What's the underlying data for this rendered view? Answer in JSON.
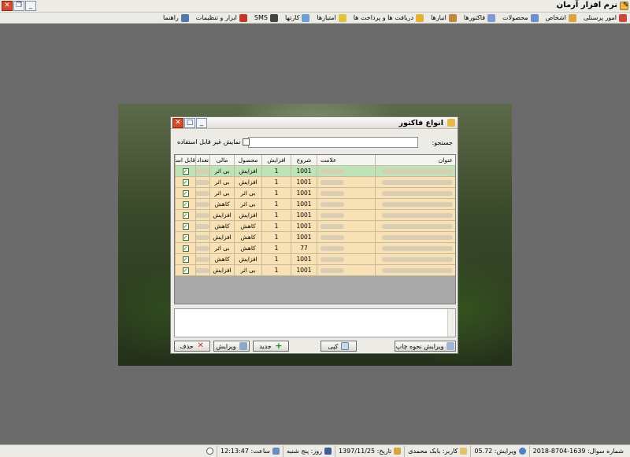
{
  "app": {
    "title": "نرم افزار آرمان"
  },
  "menu": {
    "items": [
      {
        "label": "امور پرسنلی",
        "icon": "staff-icon",
        "color": "#c94a3a"
      },
      {
        "label": "اشخاص",
        "icon": "people-icon",
        "color": "#d9a441"
      },
      {
        "label": "محصولات",
        "icon": "products-icon",
        "color": "#6b8fcf"
      },
      {
        "label": "فاکتورها",
        "icon": "invoices-icon",
        "color": "#7d9bd1"
      },
      {
        "label": "انبارها",
        "icon": "warehouse-icon",
        "color": "#b98b3b"
      },
      {
        "label": "دریافت ها و پرداخت ها",
        "icon": "payments-icon",
        "color": "#e1b23a"
      },
      {
        "label": "امتیازها",
        "icon": "points-icon",
        "color": "#e3c23b"
      },
      {
        "label": "کارتها",
        "icon": "cards-icon",
        "color": "#6aa0d6"
      },
      {
        "label": "SMS",
        "icon": "sms-icon",
        "color": "#444444"
      },
      {
        "label": "ابزار و تنظیمات",
        "icon": "tools-icon",
        "color": "#c0392b"
      },
      {
        "label": "راهنما",
        "icon": "help-icon",
        "color": "#5577aa"
      }
    ]
  },
  "dialog": {
    "title": "انواع فاکتور",
    "search_label": "جستجو:",
    "search_value": "",
    "show_unusable_label": "نمایش غیر قابل استفاده",
    "columns": {
      "title": "عنوان",
      "sign": "علامت",
      "start": "شروع",
      "effect": "افزایش",
      "product": "محصول",
      "financial": "مالی",
      "count": "تعداد",
      "usable": "قابل استفاده"
    },
    "rows": [
      {
        "start": "1001",
        "effect": "1",
        "product": "افزایش",
        "financial": "بی اثر",
        "usable": "✓",
        "selected": true
      },
      {
        "start": "1001",
        "effect": "1",
        "product": "افزایش",
        "financial": "بی اثر",
        "usable": "✓"
      },
      {
        "start": "1001",
        "effect": "1",
        "product": "بی اثر",
        "financial": "بی اثر",
        "usable": "✓"
      },
      {
        "start": "1001",
        "effect": "1",
        "product": "بی اثر",
        "financial": "کاهش",
        "usable": "✓"
      },
      {
        "start": "1001",
        "effect": "1",
        "product": "افزایش",
        "financial": "افزایش",
        "usable": "✓"
      },
      {
        "start": "1001",
        "effect": "1",
        "product": "کاهش",
        "financial": "کاهش",
        "usable": "✓"
      },
      {
        "start": "1001",
        "effect": "1",
        "product": "کاهش",
        "financial": "افزایش",
        "usable": "✓"
      },
      {
        "start": "77",
        "effect": "1",
        "product": "کاهش",
        "financial": "بی اثر",
        "usable": "✓"
      },
      {
        "start": "1001",
        "effect": "1",
        "product": "افزایش",
        "financial": "کاهش",
        "usable": "✓"
      },
      {
        "start": "1001",
        "effect": "1",
        "product": "بی اثر",
        "financial": "افزایش",
        "usable": "✓"
      }
    ],
    "buttons": {
      "edit_print": "ویرایش نحوه چاپ",
      "copy": "کپی",
      "new": "جدید",
      "edit": "ویرایش",
      "delete": "حذف"
    }
  },
  "status": {
    "question_number": "شماره سوال: 1639-8704-2018",
    "version": "ویرایش: 05.72",
    "user": "کاربر: بابک محمدی",
    "date": "تاریخ: 1397/11/25",
    "day": "روز: پنج شنبه",
    "time": "ساعت: 12:13:47"
  }
}
